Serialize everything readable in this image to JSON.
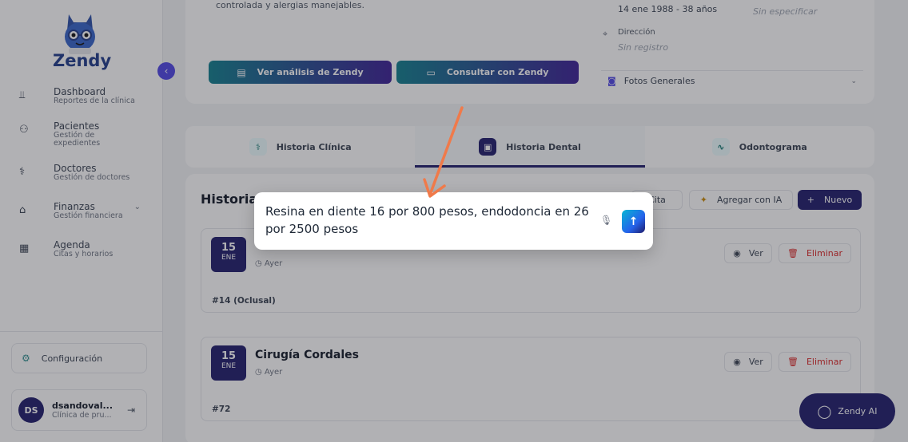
{
  "sidebar": {
    "brand": "Zendy",
    "items": [
      {
        "label": "Dashboard",
        "sub": "Reportes de la clínica",
        "icon": "chart-icon"
      },
      {
        "label": "Pacientes",
        "sub": "Gestión de expedientes",
        "icon": "users-icon"
      },
      {
        "label": "Doctores",
        "sub": "Gestión de doctores",
        "icon": "stethoscope-icon"
      },
      {
        "label": "Finanzas",
        "sub": "Gestión financiera",
        "icon": "bank-icon"
      },
      {
        "label": "Agenda",
        "sub": "Citas y horarios",
        "icon": "calendar-icon"
      }
    ],
    "config_label": "Configuración",
    "user": {
      "initials": "DS",
      "name": "dsandoval...",
      "clinic": "Clínica de pru..."
    }
  },
  "patient": {
    "summary_tail": "controlada y alergias manejables.",
    "btn_analysis": "Ver análisis de Zendy",
    "btn_consult": "Consultar con Zendy",
    "birth": "14 ene 1988 - 38 años",
    "other_value": "Sin especificar",
    "address_label": "Dirección",
    "address_value": "Sin registro",
    "fotos_label": "Fotos Generales"
  },
  "tabs": [
    {
      "label": "Historia Clínica"
    },
    {
      "label": "Historia Dental"
    },
    {
      "label": "Odontograma"
    }
  ],
  "list": {
    "title": "Historia",
    "btn_cita": "Cita",
    "btn_ia": "Agregar con IA",
    "btn_new": "Nuevo",
    "records": [
      {
        "day": "15",
        "month": "ENE",
        "title": "",
        "time": "Ayer",
        "tooth": "#14 (Oclusal)"
      },
      {
        "day": "15",
        "month": "ENE",
        "title": "Cirugía Cordales",
        "time": "Ayer",
        "tooth": "#72"
      }
    ],
    "ver_label": "Ver",
    "delete_label": "Eliminar"
  },
  "fab_label": "Zendy AI",
  "prompt": {
    "text": "Resina en diente 16 por 800 pesos, endodoncia en 26 por 2500 pesos"
  },
  "colors": {
    "accent": "#1e1b6b",
    "arrow": "#f07a4a",
    "danger": "#dc2626"
  }
}
